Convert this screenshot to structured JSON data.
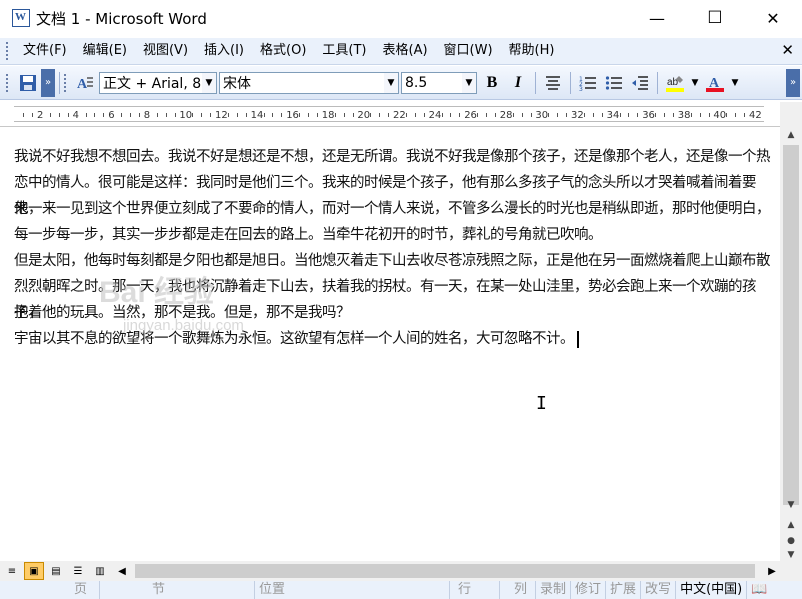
{
  "window": {
    "title": "文档 1 - Microsoft Word",
    "minimize": "—",
    "maximize": "☐",
    "close": "✕"
  },
  "menubar": {
    "items": [
      "文件(F)",
      "编辑(E)",
      "视图(V)",
      "插入(I)",
      "格式(O)",
      "工具(T)",
      "表格(A)",
      "窗口(W)",
      "帮助(H)"
    ],
    "close": "✕"
  },
  "toolbar": {
    "style_value": "正文 + Arial, 8",
    "font_value": "宋体",
    "size_value": "8.5",
    "bold": "B",
    "italic": "I",
    "highlight_color": "#ffff00",
    "font_color": "#e81123"
  },
  "ruler": {
    "labels": [
      "2",
      "4",
      "6",
      "8",
      "10",
      "12",
      "14",
      "16",
      "18",
      "20",
      "22",
      "24",
      "26",
      "28",
      "30",
      "32",
      "34",
      "36",
      "38",
      "40",
      "42"
    ]
  },
  "document": {
    "lines": [
      "我说不好我想不想回去。我说不好是想还是不想，还是无所谓。我说不好我是像那个孩子，还是像那个老人，还是像一个热",
      "恋中的情人。很可能是这样：我同时是他们三个。我来的时候是个孩子，他有那么多孩子气的念头所以才哭着喊着闹着要来，",
      "他一来一见到这个世界便立刻成了不要命的情人，而对一个情人来说，不管多么漫长的时光也是稍纵即逝，那时他便明白，",
      "每一步每一步，其实一步步都是走在回去的路上。当牵牛花初开的时节，葬礼的号角就已吹响。",
      "但是太阳，他每时每刻都是夕阳也都是旭日。当他熄灭着走下山去收尽苍凉残照之际，正是他在另一面燃烧着爬上山巅布散",
      "烈烈朝晖之时。那一天，我也将沉静着走下山去，扶着我的拐杖。有一天，在某一处山洼里，势必会跑上来一个欢蹦的孩子，",
      "抱着他的玩具。当然，那不是我。但是，那不是我吗？",
      "宇宙以其不息的欲望将一个歌舞炼为永恒。这欲望有怎样一个人间的姓名，大可忽略不计。"
    ],
    "watermark": "Bai 经验",
    "watermark_sub": "jingyan.baidu.com"
  },
  "statusbar": {
    "page": "页",
    "section": "节",
    "position": "位置",
    "line": "行",
    "column": "列",
    "rec": "录制",
    "trk": "修订",
    "ext": "扩展",
    "ovr": "改写",
    "language": "中文(中国)"
  }
}
